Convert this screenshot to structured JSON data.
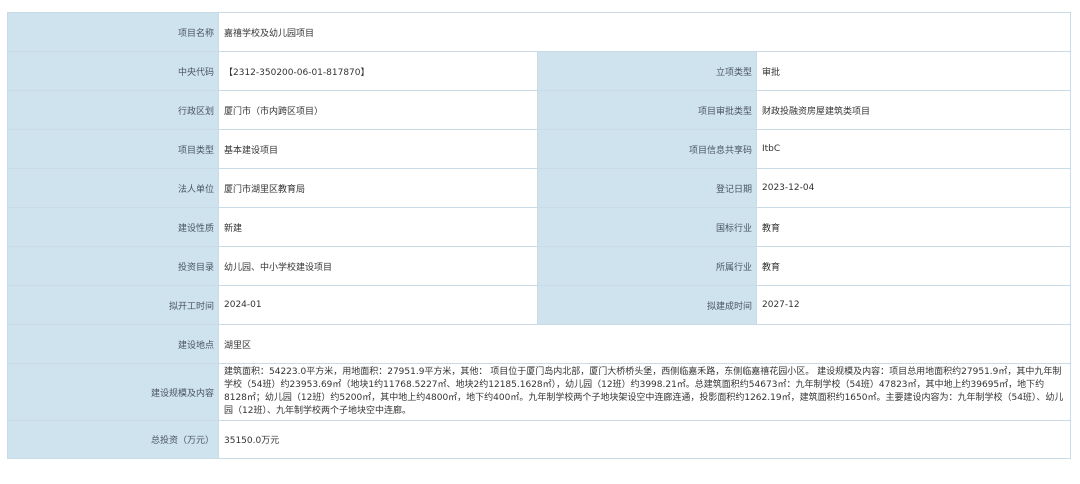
{
  "rows": {
    "project_name": {
      "label": "项目名称",
      "value": "嘉禧学校及幼儿园项目"
    },
    "central_code": {
      "label": "中央代码",
      "value": "【2312-350200-06-01-817870】"
    },
    "approval_type": {
      "label": "立项类型",
      "value": "审批"
    },
    "admin_region": {
      "label": "行政区划",
      "value": "厦门市（市内跨区项目）"
    },
    "review_type": {
      "label": "项目审批类型",
      "value": "财政投融资房屋建筑类项目"
    },
    "project_type": {
      "label": "项目类型",
      "value": "基本建设项目"
    },
    "share_code": {
      "label": "项目信息共享码",
      "value": "ItbC"
    },
    "legal_unit": {
      "label": "法人单位",
      "value": "厦门市湖里区教育局"
    },
    "reg_date": {
      "label": "登记日期",
      "value": "2023-12-04"
    },
    "nature": {
      "label": "建设性质",
      "value": "新建"
    },
    "national_industry": {
      "label": "国标行业",
      "value": "教育"
    },
    "invest_catalog": {
      "label": "投资目录",
      "value": "幼儿园、中小学校建设项目"
    },
    "industry": {
      "label": "所属行业",
      "value": "教育"
    },
    "start_time": {
      "label": "拟开工时间",
      "value": "2024-01"
    },
    "finish_time": {
      "label": "拟建成时间",
      "value": "2027-12"
    },
    "location": {
      "label": "建设地点",
      "value": "湖里区"
    },
    "scale": {
      "label": "建设规模及内容",
      "value": "建筑面积：54223.0平方米，用地面积：27951.9平方米，其他： 项目位于厦门岛内北部，厦门大桥桥头堡，西侧临嘉禾路，东侧临嘉禧花园小区。 建设规模及内容：项目总用地面积约27951.9㎡，其中九年制学校（54班）约23953.69㎡（地块1约11768.5227㎡、地块2约12185.1628㎡），幼儿园（12班）约3998.21㎡。总建筑面积约54673㎡：九年制学校（54班）47823㎡，其中地上约39695㎡，地下约8128㎡；幼儿园（12班）约5200㎡，其中地上约4800㎡，地下约400㎡。九年制学校两个子地块架设空中连廊连通，投影面积约1262.19㎡，建筑面积约1650㎡。主要建设内容为：九年制学校（54班）、幼儿园（12班）、九年制学校两个子地块空中连廊。"
    },
    "total_invest": {
      "label": "总投资（万元）",
      "value": "35150.0万元"
    }
  }
}
